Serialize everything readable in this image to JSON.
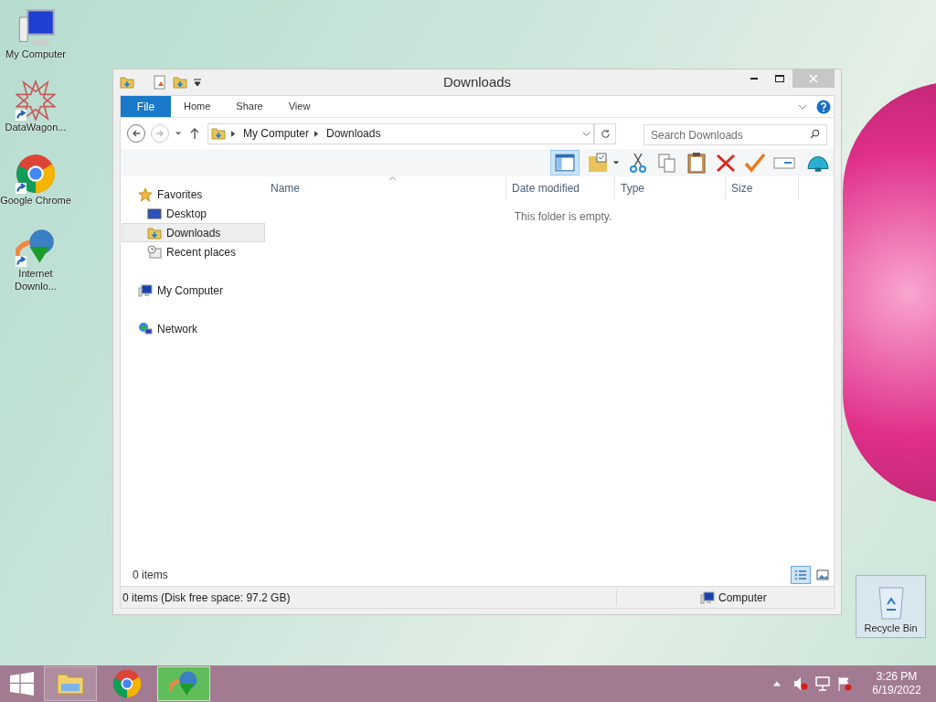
{
  "desktop_icons": [
    {
      "kind": "computer",
      "label": "My Computer",
      "selected": false
    },
    {
      "kind": "star",
      "label": "DataWagon...",
      "selected": false
    },
    {
      "kind": "chrome",
      "label": "Google Chrome",
      "selected": false
    },
    {
      "kind": "idm",
      "label": "Internet Downlo...",
      "selected": false
    }
  ],
  "recycle_bin": {
    "label": "Recycle Bin",
    "selected": true
  },
  "window": {
    "title": "Downloads",
    "ribbon_tabs": [
      {
        "kind": "file",
        "label": "File"
      },
      {
        "kind": "tab",
        "label": "Home"
      },
      {
        "kind": "tab",
        "label": "Share"
      },
      {
        "kind": "tab",
        "label": "View"
      }
    ],
    "path": [
      "My Computer",
      "Downloads"
    ],
    "search": {
      "placeholder": "Search Downloads"
    },
    "nav": [
      {
        "kind": "favorites",
        "label": "Favorites",
        "selected": false,
        "children": [
          {
            "kind": "desktop",
            "label": "Desktop",
            "selected": false
          },
          {
            "kind": "downloads",
            "label": "Downloads",
            "selected": true
          },
          {
            "kind": "recent",
            "label": "Recent places",
            "selected": false
          }
        ]
      },
      {
        "kind": "computer",
        "label": "My Computer",
        "selected": false
      },
      {
        "kind": "network",
        "label": "Network",
        "selected": false
      }
    ],
    "columns": [
      "Name",
      "Date modified",
      "Type",
      "Size"
    ],
    "empty_message": "This folder is empty.",
    "item_count": "0 items",
    "status_text": "0 items (Disk free space: 97.2 GB)",
    "status_location": "Computer"
  },
  "taskbar": {
    "apps": [
      {
        "kind": "explorer",
        "open": true,
        "selected": false
      },
      {
        "kind": "chrome",
        "open": false,
        "selected": false
      },
      {
        "kind": "idm",
        "open": true,
        "selected": true
      }
    ],
    "time": "3:26 PM",
    "date": "6/19/2022"
  }
}
